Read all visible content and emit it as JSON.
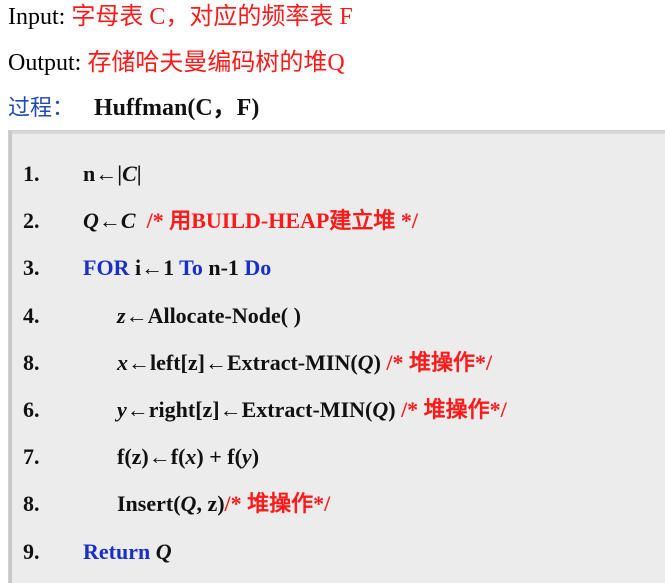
{
  "header": {
    "input_key": "Input:",
    "input_value": "字母表 C，对应的频率表 F",
    "output_key": "Output:",
    "output_value": "存储哈夫曼编码树的堆Q",
    "process_key": "过程：",
    "process_value": "Huffman(C，F)"
  },
  "algorithm": {
    "lines": [
      {
        "num": "1.",
        "parts": [
          {
            "t": "n←|"
          },
          {
            "t": "C",
            "i": true
          },
          {
            "t": "|"
          }
        ]
      },
      {
        "num": "2.",
        "parts": [
          {
            "t": "Q",
            "i": true
          },
          {
            "t": "←"
          },
          {
            "t": "C",
            "i": true
          },
          {
            "t": "  /* 用BUILD-HEAP建立堆 */",
            "c": "red"
          }
        ]
      },
      {
        "num": "3.",
        "parts": [
          {
            "t": "FOR",
            "c": "blue"
          },
          {
            "t": " i←1 "
          },
          {
            "t": "To",
            "c": "blue"
          },
          {
            "t": " n-1 "
          },
          {
            "t": "Do",
            "c": "blue"
          }
        ]
      },
      {
        "num": "4.",
        "indent": true,
        "parts": [
          {
            "t": "z",
            "i": true
          },
          {
            "t": "←Allocate-Node( )"
          }
        ]
      },
      {
        "num": "8.",
        "indent": true,
        "parts": [
          {
            "t": "x",
            "i": true
          },
          {
            "t": "←left[z]←Extract-MIN("
          },
          {
            "t": "Q",
            "i": true
          },
          {
            "t": ") "
          },
          {
            "t": "/* 堆操作*/",
            "c": "red"
          }
        ]
      },
      {
        "num": "6.",
        "indent": true,
        "parts": [
          {
            "t": "y",
            "i": true
          },
          {
            "t": "←right[z]←Extract-MIN("
          },
          {
            "t": "Q",
            "i": true
          },
          {
            "t": ") "
          },
          {
            "t": "/* 堆操作*/",
            "c": "red"
          }
        ]
      },
      {
        "num": "7.",
        "indent": true,
        "parts": [
          {
            "t": "f(z)←f("
          },
          {
            "t": "x",
            "i": true
          },
          {
            "t": ") + f("
          },
          {
            "t": "y",
            "i": true
          },
          {
            "t": ")"
          }
        ]
      },
      {
        "num": "8.",
        "indent": true,
        "parts": [
          {
            "t": "Insert("
          },
          {
            "t": "Q",
            "i": true
          },
          {
            "t": ", z)"
          },
          {
            "t": "/* 堆操作*/",
            "c": "red"
          }
        ]
      },
      {
        "num": "9.",
        "parts": [
          {
            "t": "Return ",
            "c": "blue"
          },
          {
            "t": "Q",
            "i": true
          }
        ]
      }
    ]
  }
}
